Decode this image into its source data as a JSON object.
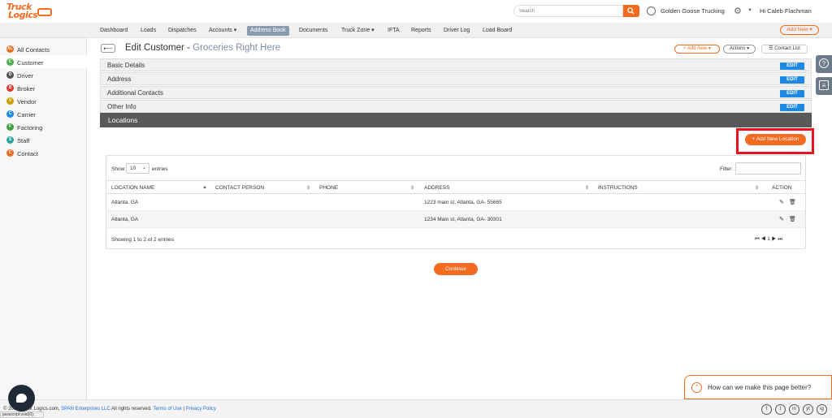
{
  "logo": {
    "line1": "Truck",
    "line2": "Logics"
  },
  "header": {
    "search_placeholder": "Search",
    "company": "Golden Goose Trucking",
    "greeting": "Hi Caleb Flachman"
  },
  "nav": {
    "items": [
      "Dashboard",
      "Loads",
      "Dispatches",
      "Accounts ▾",
      "Address Book",
      "Documents",
      "Truck Zone ▾",
      "IFTA",
      "Reports",
      "Driver Log",
      "Load Board"
    ],
    "active": "Address Book",
    "add_new": "Add New ▾"
  },
  "sidebar": {
    "items": [
      {
        "label": "All Contacts",
        "letter": "AL",
        "color": "#f26b21"
      },
      {
        "label": "Customer",
        "letter": "C",
        "color": "#4caf50"
      },
      {
        "label": "Driver",
        "letter": "D",
        "color": "#555555"
      },
      {
        "label": "Broker",
        "letter": "B",
        "color": "#e53935"
      },
      {
        "label": "Vendor",
        "letter": "V",
        "color": "#c8a000"
      },
      {
        "label": "Carrier",
        "letter": "C",
        "color": "#1e88e5"
      },
      {
        "label": "Factoring",
        "letter": "F",
        "color": "#43a047"
      },
      {
        "label": "Staff",
        "letter": "S",
        "color": "#26a69a"
      },
      {
        "label": "Contact",
        "letter": "C",
        "color": "#f26b21"
      }
    ],
    "active": "Customer"
  },
  "page": {
    "back": "⟵",
    "title": "Edit Customer - ",
    "customer": "Groceries Right Here",
    "add_new": "+ Add New ▾",
    "actions": "Actions ▾",
    "contact_list": "☰ Contact List"
  },
  "sections": [
    {
      "label": "Basic Details",
      "edit": "EDIT"
    },
    {
      "label": "Address",
      "edit": "EDIT"
    },
    {
      "label": "Additional Contacts",
      "edit": "EDIT"
    },
    {
      "label": "Other Info",
      "edit": "EDIT"
    }
  ],
  "locations": {
    "title": "Locations",
    "add_button": "+ Add New Location",
    "show_label": "Show",
    "show_value": "10",
    "entries_label": "entries",
    "filter_label": "Filter:",
    "columns": [
      "LOCATION NAME",
      "CONTACT PERSON",
      "PHONE",
      "ADDRESS",
      "INSTRUCTIONS",
      "ACTION"
    ],
    "rows": [
      {
        "name": "Atlanta, GA",
        "contact": "",
        "phone": "",
        "address": "1223 main st, Atlanta, GA- 55665",
        "instructions": ""
      },
      {
        "name": "Atlanta, GA",
        "contact": "",
        "phone": "",
        "address": "1234 Main st, Atlanta, GA- 30301",
        "instructions": ""
      }
    ],
    "showing": "Showing 1 to 2 of 2 entries",
    "pager": "⏮ ◀ 1 ▶ ⏭"
  },
  "continue_label": "Continue",
  "feedback": "How can we make this page better?",
  "footer": {
    "prefix": "© 2019 Truck Logics.com, ",
    "span": "SPAN Enterprises LLC",
    "rights": " All rights reserved. ",
    "terms": "Terms of Use",
    "sep": " | ",
    "privacy": "Privacy Policy"
  },
  "status_bar": "javascript:void(0);",
  "social_icons": [
    "f",
    "t",
    "in",
    "yt",
    "ig"
  ]
}
